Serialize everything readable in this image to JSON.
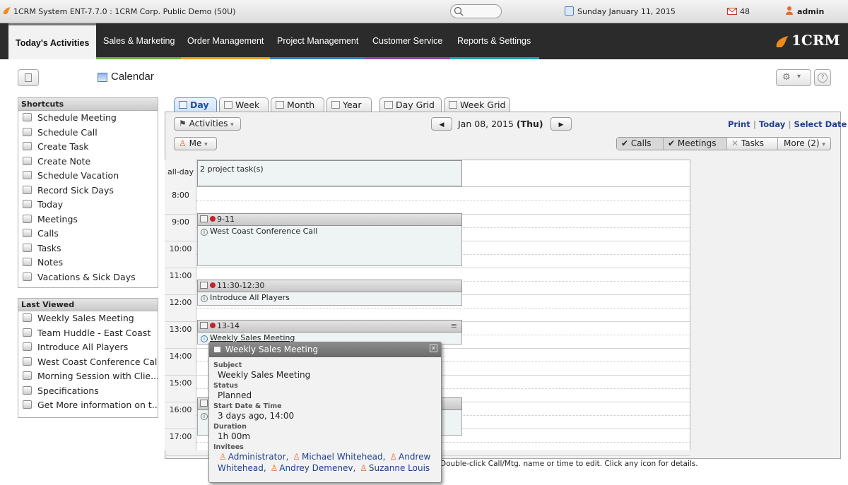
{
  "titlebar": {
    "title": "1CRM System ENT-7.7.0 : 1CRM Corp. Public Demo (50U)",
    "date": "Sunday January 11, 2015",
    "mail_count": "48",
    "user": "admin"
  },
  "nav": {
    "items": [
      "Today's Activities",
      "Sales & Marketing",
      "Order Management",
      "Project Management",
      "Customer Service",
      "Reports & Settings"
    ],
    "brand": "1CRM"
  },
  "page": {
    "title": "Calendar"
  },
  "shortcuts": {
    "title": "Shortcuts",
    "items": [
      "Schedule Meeting",
      "Schedule Call",
      "Create Task",
      "Create Note",
      "Schedule Vacation",
      "Record Sick Days",
      "Today",
      "Meetings",
      "Calls",
      "Tasks",
      "Notes",
      "Vacations & Sick Days"
    ]
  },
  "last_viewed": {
    "title": "Last Viewed",
    "items": [
      "Weekly Sales Meeting",
      "Team Huddle - East Coast",
      "Introduce All Players",
      "West Coast Conference Call",
      "Morning Session with Clie...",
      "Specifications",
      "Get More information on t..."
    ]
  },
  "tabs": [
    "Day",
    "Week",
    "Month",
    "Year",
    "Day Grid",
    "Week Grid"
  ],
  "toolbar": {
    "activities": "Activities",
    "me": "Me",
    "date": "Jan 08, 2015",
    "weekday": "(Thu)",
    "print": "Print",
    "today": "Today",
    "select_date": "Select Date",
    "calls": "Calls",
    "meetings": "Meetings",
    "tasks": "Tasks",
    "more": "More (2)"
  },
  "calendar": {
    "allday_label": "all-day",
    "allday_text": "2 project task(s)",
    "hours": [
      "8:00",
      "9:00",
      "10:00",
      "11:00",
      "12:00",
      "13:00",
      "14:00",
      "15:00",
      "16:00",
      "17:00"
    ],
    "events": [
      {
        "time": "9-11",
        "title": "West Coast Conference Call"
      },
      {
        "time": "11:30-12:30",
        "title": "Introduce All Players"
      },
      {
        "time": "13-14",
        "title": "Weekly Sales Meeting"
      }
    ],
    "footer": "Double-click Call/Mtg. name or time to edit.  Click any icon for details."
  },
  "popup": {
    "title": "Weekly Sales Meeting",
    "subject_label": "Subject",
    "subject": "Weekly Sales Meeting",
    "status_label": "Status",
    "status": "Planned",
    "start_label": "Start Date & Time",
    "start": "3 days ago, 14:00",
    "duration_label": "Duration",
    "duration": "1h 00m",
    "invitees_label": "Invitees",
    "invitees": [
      "Administrator,",
      "Michael Whitehead,",
      "Andrew Whitehead,",
      "Andrey Demenev,",
      "Suzanne Louis"
    ]
  },
  "colors": {
    "nav_bg": "#2b2b2b",
    "accent_blue": "#1f3f8f",
    "event_dot": "#c0272d",
    "nav_lines": [
      "#6db33f",
      "#e8a21d",
      "#2f7fc8",
      "#8e44ad",
      "#18a2b8",
      "#d8452b"
    ]
  }
}
